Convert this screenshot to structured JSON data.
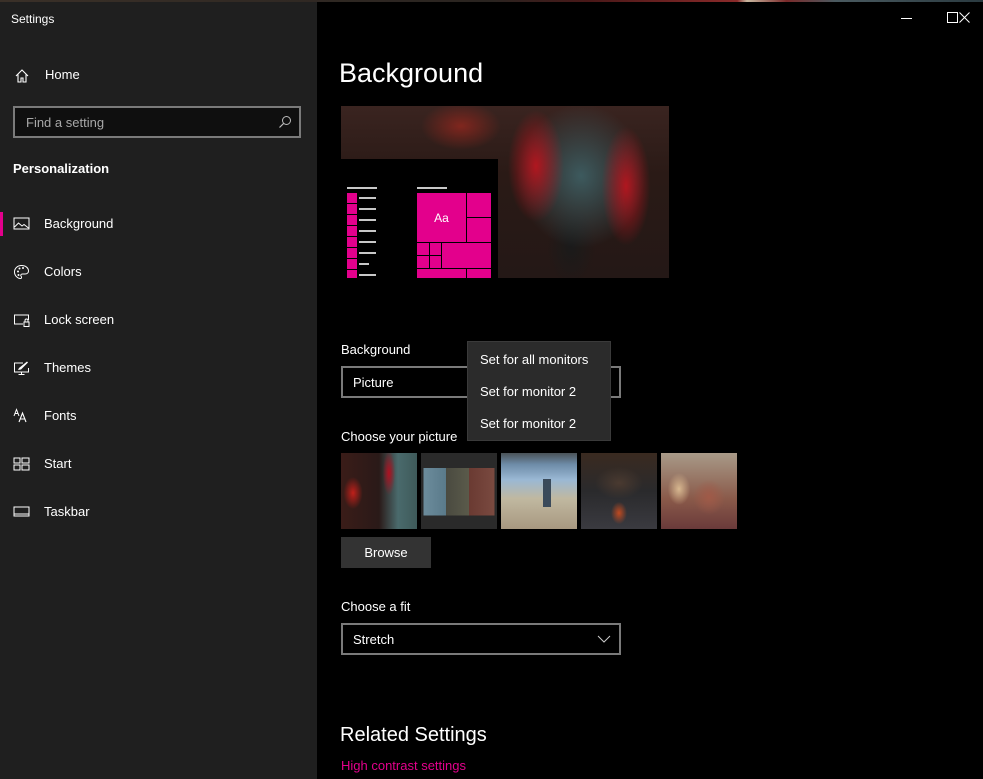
{
  "window": {
    "title": "Settings",
    "controls": {
      "minimize": "minimize-icon",
      "maximize": "maximize-icon",
      "close": "close-icon"
    }
  },
  "sidebar": {
    "home_label": "Home",
    "home_icon": "home-icon",
    "search": {
      "placeholder": "Find a setting",
      "value": "",
      "icon": "search-icon"
    },
    "section_title": "Personalization",
    "items": [
      {
        "label": "Background",
        "icon": "picture-icon",
        "selected": true
      },
      {
        "label": "Colors",
        "icon": "palette-icon",
        "selected": false
      },
      {
        "label": "Lock screen",
        "icon": "lock-screen-icon",
        "selected": false
      },
      {
        "label": "Themes",
        "icon": "themes-icon",
        "selected": false
      },
      {
        "label": "Fonts",
        "icon": "fonts-icon",
        "selected": false
      },
      {
        "label": "Start",
        "icon": "start-icon",
        "selected": false
      },
      {
        "label": "Taskbar",
        "icon": "taskbar-icon",
        "selected": false
      }
    ]
  },
  "main": {
    "page_title": "Background",
    "preview": {
      "tile_text": "Aa"
    },
    "background_field": {
      "label": "Background",
      "value": "Picture"
    },
    "context_menu": {
      "items": [
        "Set for all monitors",
        "Set for monitor 2",
        "Set for monitor 2"
      ]
    },
    "picture_field": {
      "label": "Choose your picture",
      "thumbnails": [
        "thumbnail-1",
        "thumbnail-2",
        "thumbnail-3",
        "thumbnail-4",
        "thumbnail-5"
      ],
      "browse_label": "Browse"
    },
    "fit_field": {
      "label": "Choose a fit",
      "value": "Stretch"
    },
    "related": {
      "title": "Related Settings",
      "links": [
        "High contrast settings"
      ]
    }
  },
  "colors": {
    "accent": "#e3008c",
    "sidebar_bg": "#1f1f1f",
    "main_bg": "#000000",
    "menu_bg": "#2b2b2b"
  }
}
